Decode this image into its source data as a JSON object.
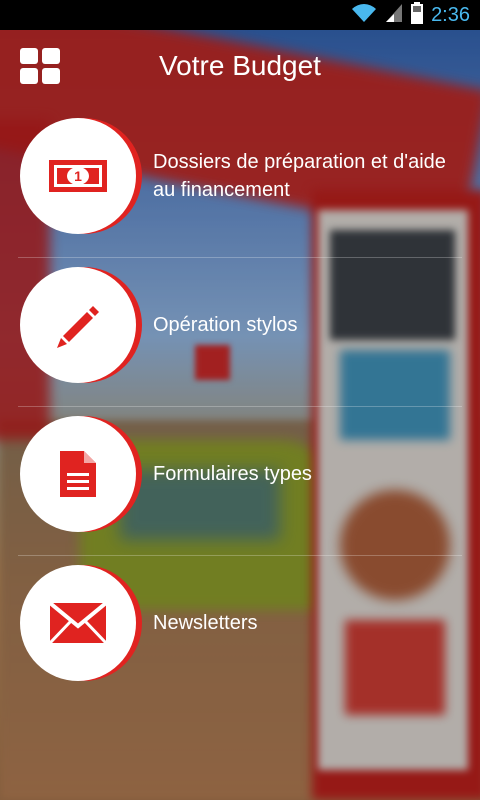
{
  "status_bar": {
    "time": "2:36",
    "icons": [
      "wifi-icon",
      "signal-icon",
      "battery-icon"
    ]
  },
  "header": {
    "title": "Votre Budget",
    "menu_icon": "grid-menu-icon"
  },
  "accent_color": "#e02320",
  "items": [
    {
      "label": "Dossiers de préparation et d'aide au financement",
      "icon": "banknote-icon"
    },
    {
      "label": "Opération stylos",
      "icon": "pencil-icon"
    },
    {
      "label": "Formulaires types",
      "icon": "document-icon"
    },
    {
      "label": "Newsletters",
      "icon": "envelope-icon"
    }
  ]
}
